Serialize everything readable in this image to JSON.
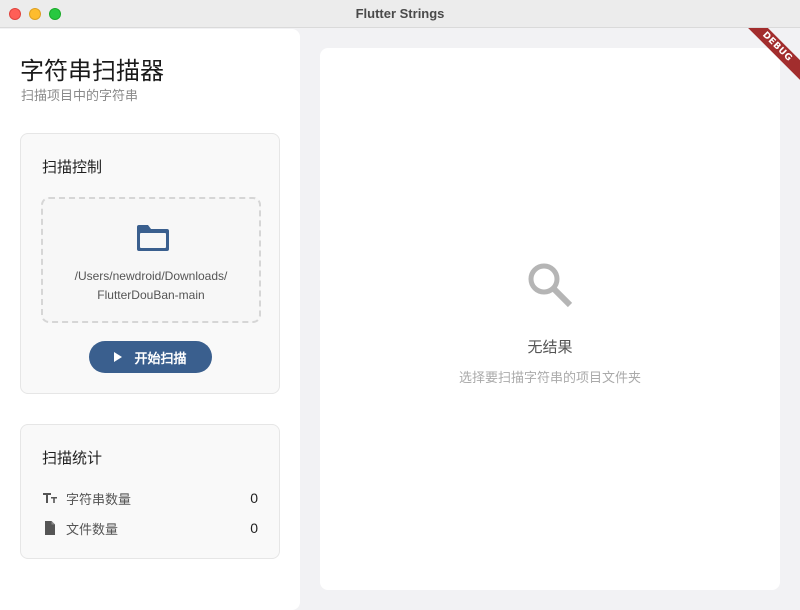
{
  "window": {
    "title": "Flutter Strings"
  },
  "sidebar": {
    "title": "字符串扫描器",
    "subtitle": "扫描项目中的字符串",
    "control_card": {
      "title": "扫描控制",
      "folder_path_line1": "/Users/newdroid/Downloads/",
      "folder_path_line2": "FlutterDouBan-main",
      "folder_icon": "folder-icon",
      "start_button": "开始扫描",
      "start_icon": "play-icon"
    },
    "stats_card": {
      "title": "扫描统计",
      "rows": [
        {
          "icon": "text-size-icon",
          "label": "字符串数量",
          "value": "0"
        },
        {
          "icon": "file-icon",
          "label": "文件数量",
          "value": "0"
        }
      ]
    }
  },
  "main": {
    "empty_icon": "search-icon",
    "empty_title": "无结果",
    "empty_subtitle": "选择要扫描字符串的项目文件夹"
  },
  "debug_banner": "DEBUG",
  "colors": {
    "accent": "#3a5f8e",
    "ribbon": "#a22d2d",
    "icon_gray": "#b5b5b5"
  }
}
